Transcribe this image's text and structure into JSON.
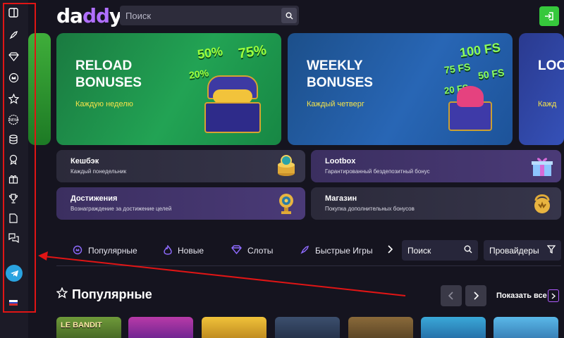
{
  "header": {
    "logo_main": "da",
    "logo_accent": "dd",
    "logo_end": "y",
    "search_placeholder": "Поиск"
  },
  "banners": [
    {
      "title": "RELOAD BONUSES",
      "subtitle": "Каждую неделю",
      "numbers": [
        "50%",
        "75%",
        "20%"
      ]
    },
    {
      "title": "WEEKLY BONUSES",
      "subtitle": "Каждый четверг",
      "numbers": [
        "100 FS",
        "75 FS",
        "50 FS",
        "20 FS"
      ]
    },
    {
      "title": "LOO",
      "subtitle": "Кажд"
    }
  ],
  "cards": [
    {
      "title": "Кешбэк",
      "subtitle": "Каждый понедельник"
    },
    {
      "title": "Lootbox",
      "subtitle": "Гарантированный бездепозитный бонус"
    },
    {
      "title": "Достижения",
      "subtitle": "Вознаграждение за достижение целей"
    },
    {
      "title": "Магазин",
      "subtitle": "Покупка дополнительных бонусов"
    }
  ],
  "categories": [
    "Популярные",
    "Новые",
    "Слоты",
    "Быстрые Игры"
  ],
  "filters": {
    "search_label": "Поиск",
    "providers_label": "Провайдеры"
  },
  "section": {
    "title": "Популярные",
    "show_all": "Показать все"
  },
  "games": [
    {
      "label": "LE BANDIT"
    }
  ],
  "colors": {
    "accent": "#8f6bff",
    "login": "#36c83c",
    "highlight_box": "#e01515"
  }
}
